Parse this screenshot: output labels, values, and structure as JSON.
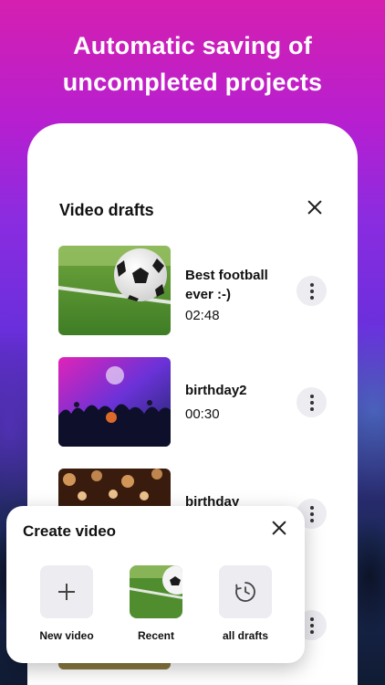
{
  "headline": {
    "line1": "Automatic saving of",
    "line2": "uncompleted projects"
  },
  "drafts_panel": {
    "title": "Video drafts",
    "close_icon": "close-icon",
    "items": [
      {
        "name": "Best football ever :-)",
        "duration": "02:48",
        "thumbnail": "football-on-grass"
      },
      {
        "name": "birthday2",
        "duration": "00:30",
        "thumbnail": "concert-crowd"
      },
      {
        "name": "birthday",
        "duration": "",
        "thumbnail": "candles"
      },
      {
        "name": "",
        "duration": "",
        "thumbnail": "outdoor"
      }
    ],
    "more_icon": "more-vertical-icon"
  },
  "create_sheet": {
    "title": "Create video",
    "options": [
      {
        "label": "New video",
        "icon": "plus-icon"
      },
      {
        "label": "Recent",
        "icon": "football-thumbnail"
      },
      {
        "label": "all drafts",
        "icon": "clock-icon"
      }
    ]
  },
  "colors": {
    "accent_pink": "#d51fb0",
    "accent_purple": "#6a2fdc",
    "card_bg": "#ffffff",
    "button_bg": "#ececf1"
  }
}
